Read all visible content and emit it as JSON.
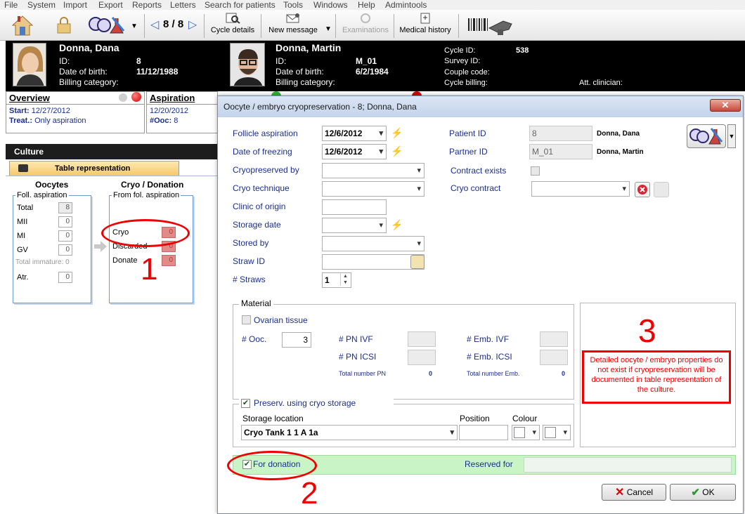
{
  "menu": [
    "File",
    "System",
    "Import",
    "Export",
    "Reports",
    "Letters",
    "Search for patients",
    "Tools",
    "Windows",
    "Help",
    "Admintools"
  ],
  "toolbar": {
    "nav_counter": "8 / 8",
    "cycle_details": "Cycle details",
    "new_message": "New message",
    "examinations": "Examinations",
    "medical_history": "Medical history"
  },
  "patient": {
    "name": "Donna, Dana",
    "id_label": "ID:",
    "id": "8",
    "dob_label": "Date of birth:",
    "dob": "11/12/1988",
    "billing_label": "Billing category:"
  },
  "partner": {
    "name": "Donna, Martin",
    "id_label": "ID:",
    "id": "M_01",
    "dob_label": "Date of birth:",
    "dob": "6/2/1984",
    "billing_label": "Billing category:"
  },
  "cycle": {
    "cycle_id_label": "Cycle ID:",
    "cycle_id": "538",
    "survey_label": "Survey ID:",
    "couple_label": "Couple code:",
    "billing_label": "Cycle billing:",
    "clinician_label": "Att. clinician:"
  },
  "overview": {
    "title": "Overview",
    "start_label": "Start:",
    "start": "12/27/2012",
    "treat_label": "Treat.:",
    "treat": "Only aspiration"
  },
  "aspiration": {
    "title": "Aspiration",
    "date": "12/20/2012",
    "ooc_label": "#Ooc:",
    "ooc": "8"
  },
  "culture": {
    "title": "Culture",
    "tab": "Table representation",
    "oocytes_title": "Oocytes",
    "fol_asp_legend": "Foll. aspiration",
    "rows": [
      {
        "label": "Total",
        "value": "8"
      },
      {
        "label": "MII",
        "value": "0"
      },
      {
        "label": "MI",
        "value": "0"
      },
      {
        "label": "GV",
        "value": "0"
      }
    ],
    "total_immature": "Total immature: 0",
    "atr_label": "Atr.",
    "atr_value": "0",
    "cryo_title": "Cryo / Donation",
    "cryo_legend": "From fol. aspiration",
    "cryo_rows": [
      {
        "label": "Cryo",
        "value": "0"
      },
      {
        "label": "Discarded",
        "value": "0"
      },
      {
        "label": "Donate",
        "value": "0"
      }
    ]
  },
  "dialog": {
    "title": "Oocyte / embryo cryopreservation - 8; Donna, Dana",
    "follicle_aspiration_label": "Follicle aspiration",
    "follicle_aspiration": "12/6/2012",
    "date_freezing_label": "Date of freezing",
    "date_freezing": "12/6/2012",
    "cryopreserved_by_label": "Cryopreserved by",
    "cryo_technique_label": "Cryo technique",
    "clinic_origin_label": "Clinic of origin",
    "storage_date_label": "Storage date",
    "stored_by_label": "Stored by",
    "straw_id_label": "Straw ID",
    "straws_label": "# Straws",
    "straws": "1",
    "patient_id_label": "Patient ID",
    "patient_id": "8",
    "patient_name": "Donna, Dana",
    "partner_id_label": "Partner ID",
    "partner_id": "M_01",
    "partner_name": "Donna, Martin",
    "contract_exists_label": "Contract exists",
    "cryo_contract_label": "Cryo contract",
    "material_legend": "Material",
    "ovarian_tissue_label": "Ovarian tissue",
    "ooc_label": "# Ooc.",
    "ooc": "3",
    "pn_ivf_label": "# PN IVF",
    "pn_icsi_label": "# PN ICSI",
    "total_pn_label": "Total number PN",
    "total_pn": "0",
    "emb_ivf_label": "# Emb. IVF",
    "emb_icsi_label": "# Emb. ICSI",
    "total_emb_label": "Total number Emb.",
    "total_emb": "0",
    "info_text": "Detailed oocyte / embryo properties do not exist if cryopreservation will be documented in table representation of the culture.",
    "preserv_label": "Preserv. using cryo storage",
    "storage_location_label": "Storage location",
    "storage_location": "Cryo Tank 1 1 A 1a",
    "position_label": "Position",
    "colour_label": "Colour",
    "for_donation_label": "For donation",
    "reserved_for_label": "Reserved for",
    "cancel": "Cancel",
    "ok": "OK"
  },
  "annotations": [
    "1",
    "2",
    "3"
  ]
}
